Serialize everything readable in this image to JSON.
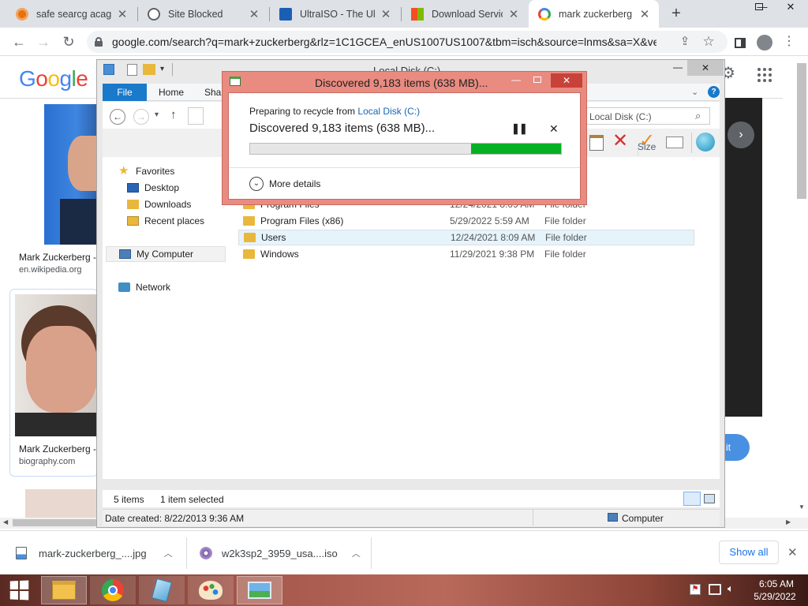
{
  "browser": {
    "tabs": [
      {
        "title": "safe searcg acagca",
        "favicon_color": "#e8710a"
      },
      {
        "title": "Site Blocked",
        "favicon_color": "#5f6368"
      },
      {
        "title": "UltraISO - The Ulti",
        "favicon_color": "#1a5fb4"
      },
      {
        "title": "Download Service",
        "favicon_color": "#f25022"
      },
      {
        "title": "mark zuckerberg -",
        "favicon_color": "#4285f4"
      }
    ],
    "url": "google.com/search?q=mark+zuckerberg&rlz=1C1GCEA_enUS1007US1007&tbm=isch&source=lnms&sa=X&ve..."
  },
  "google": {
    "logo": "Google",
    "results": [
      {
        "caption": "Mark Zuckerberg -",
        "source": "en.wikipedia.org"
      },
      {
        "caption": "Mark Zuckerberg -",
        "source": "biography.com"
      }
    ],
    "partial_button": "it"
  },
  "explorer": {
    "title": "Local Disk (C:)",
    "ribbon_tabs": [
      "File",
      "Home",
      "Shar"
    ],
    "search_placeholder": "Local Disk (C:)",
    "column_header": "Size",
    "nav": {
      "favorites": "Favorites",
      "desktop": "Desktop",
      "downloads": "Downloads",
      "recent": "Recent places",
      "computer": "My Computer",
      "network": "Network"
    },
    "files": [
      {
        "name": "Program Files",
        "date": "12/24/2021 8:09 AM",
        "type": "File folder"
      },
      {
        "name": "Program Files (x86)",
        "date": "5/29/2022 5:59 AM",
        "type": "File folder"
      },
      {
        "name": "Users",
        "date": "12/24/2021 8:09 AM",
        "type": "File folder"
      },
      {
        "name": "Windows",
        "date": "11/29/2021 9:38 PM",
        "type": "File folder"
      }
    ],
    "status_items": "5 items",
    "status_selected": "1 item selected",
    "details_date": "Date created: 8/22/2013 9:36 AM",
    "details_location": "Computer"
  },
  "dialog": {
    "title": "Discovered 9,183 items (638 MB)...",
    "preparing_prefix": "Preparing to recycle from",
    "preparing_link": "Local Disk (C:)",
    "heading": "Discovered 9,183 items (638 MB)...",
    "progress_percent": 29,
    "more_details": "More details"
  },
  "downloads": {
    "items": [
      {
        "name": "mark-zuckerberg_....jpg"
      },
      {
        "name": "w2k3sp2_3959_usa....iso"
      }
    ],
    "show_all": "Show all"
  },
  "taskbar": {
    "time": "6:05 AM",
    "date": "5/29/2022"
  },
  "colors": {
    "accent_blue": "#1979ca",
    "dialog_frame": "#e98b80",
    "progress_green": "#06b025",
    "link_blue": "#1a73e8"
  }
}
